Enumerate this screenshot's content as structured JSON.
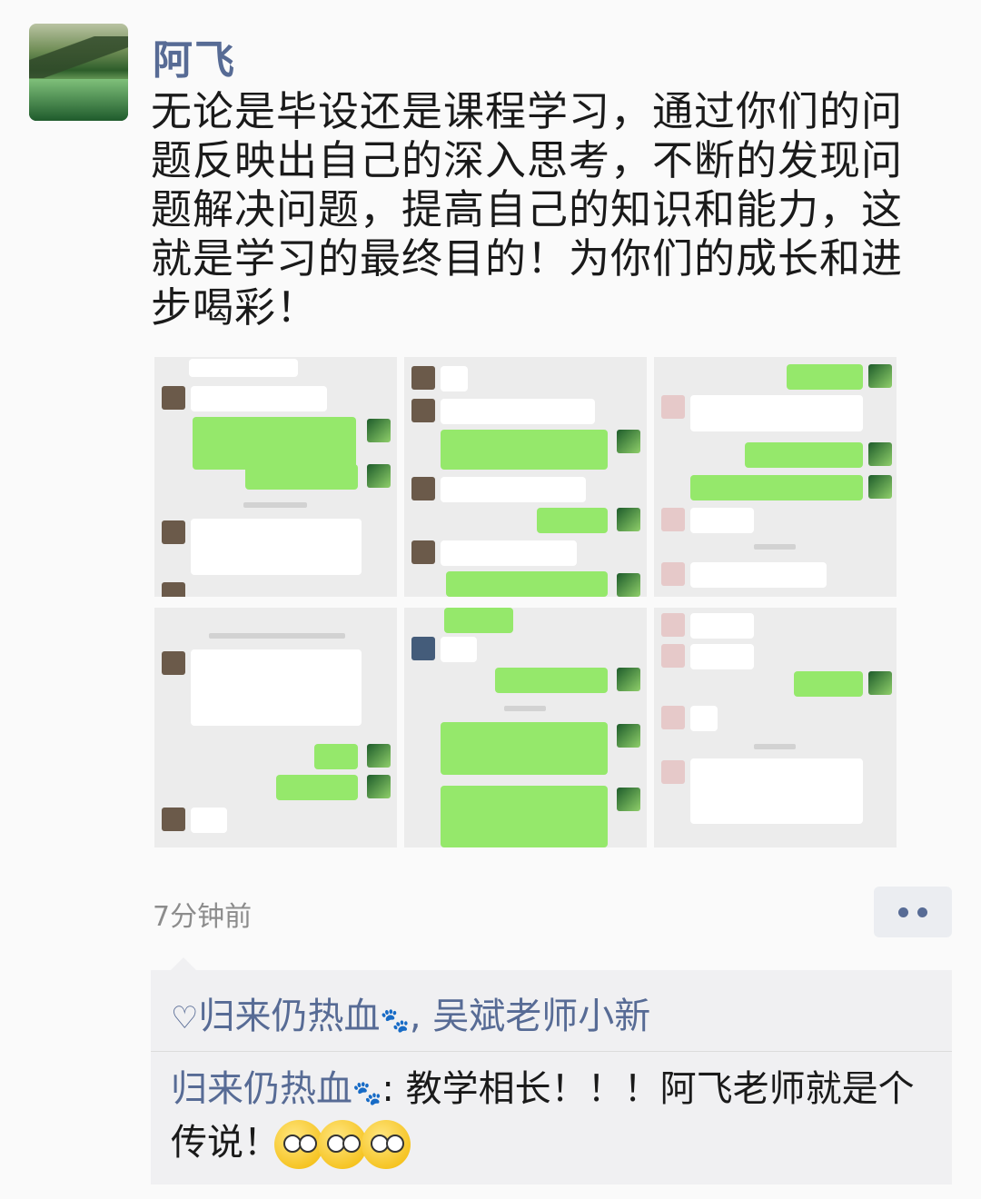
{
  "post": {
    "author": "阿飞",
    "text": "无论是毕设还是课程学习，通过你们的问题反映出自己的深入思考，不断的发现问题解决问题，提高自己的知识和能力，这就是学习的最终目的！为你们的成长和进步喝彩！",
    "time": "7分钟前"
  },
  "icons": {
    "avatar": "landscape-avatar",
    "more": "more-dots-icon",
    "like": "heart-icon",
    "paw": "paw-emoji",
    "emoji": "tongue-out-emoji"
  },
  "likes": {
    "first": "归来仍热血",
    "separator": ",",
    "second": "吴斌老师小新"
  },
  "comment": {
    "name": "归来仍热血",
    "colon": ":",
    "text": "教学相长！！！阿飞老师就是个传说！"
  },
  "colors": {
    "link": "#576b95",
    "bubble_green": "#95e86b",
    "comment_bg": "#f0f0f2"
  }
}
